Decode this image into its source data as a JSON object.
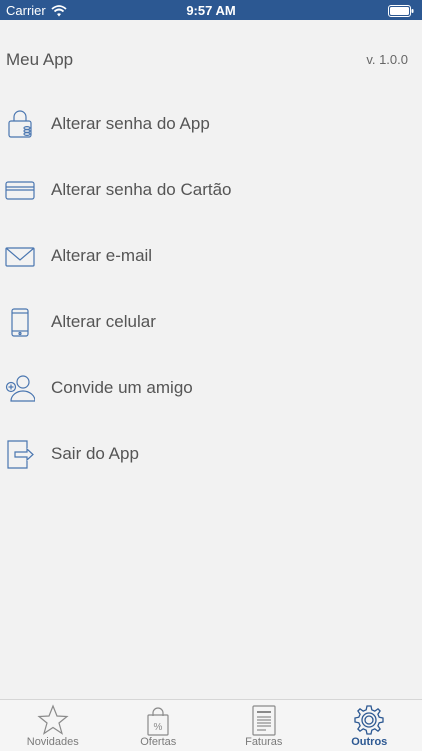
{
  "status_bar": {
    "carrier": "Carrier",
    "time": "9:57 AM"
  },
  "header": {
    "title": "Meu App",
    "version": "v. 1.0.0"
  },
  "menu": {
    "items": [
      {
        "label": "Alterar senha do App",
        "icon": "lock-icon"
      },
      {
        "label": "Alterar senha do Cartão",
        "icon": "credit-card-icon"
      },
      {
        "label": "Alterar e-mail",
        "icon": "envelope-icon"
      },
      {
        "label": "Alterar celular",
        "icon": "phone-icon"
      },
      {
        "label": "Convide um amigo",
        "icon": "add-user-icon"
      },
      {
        "label": "Sair do App",
        "icon": "exit-icon"
      }
    ]
  },
  "tab_bar": {
    "tabs": [
      {
        "label": "Novidades",
        "icon": "star-icon"
      },
      {
        "label": "Ofertas",
        "icon": "shopping-bag-percent-icon"
      },
      {
        "label": "Faturas",
        "icon": "invoice-icon"
      },
      {
        "label": "Outros",
        "icon": "gear-icon",
        "active": true
      }
    ]
  },
  "colors": {
    "accent": "#2c5892",
    "icon": "#4a76b0",
    "text": "#555555",
    "background": "#f2f2f2"
  }
}
